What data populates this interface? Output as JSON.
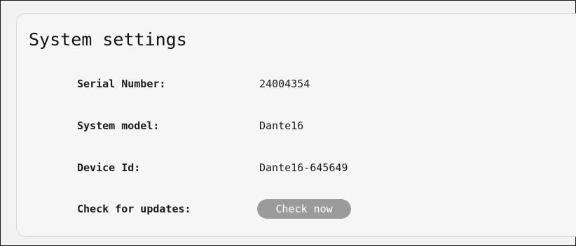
{
  "page": {
    "title": "System settings"
  },
  "settings": {
    "serial_number": {
      "label": "Serial Number:",
      "value": "24004354"
    },
    "system_model": {
      "label": "System model:",
      "value": "Dante16"
    },
    "device_id": {
      "label": "Device Id:",
      "value": "Dante16-645649"
    },
    "updates": {
      "label": "Check for updates:",
      "button_label": "Check now"
    }
  },
  "colors": {
    "background": "#f2f2f2",
    "card": "#f6f6f6",
    "button": "#9b9b9b",
    "button_text": "#ffffff",
    "text": "#111111"
  }
}
